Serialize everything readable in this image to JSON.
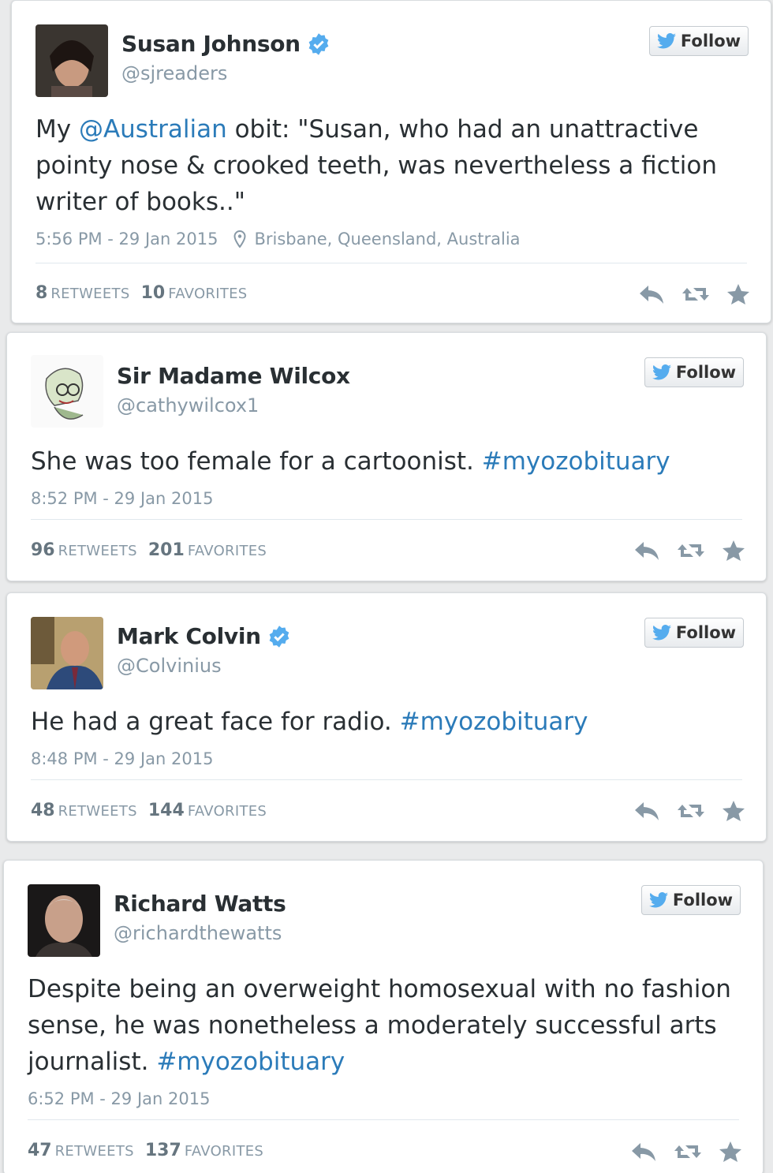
{
  "colors": {
    "link": "#2b7bb9",
    "verified": "#55acee",
    "muted": "#8899a6"
  },
  "follow_label": "Follow",
  "tweets": [
    {
      "name": "Susan Johnson",
      "verified": true,
      "handle": "@sjreaders",
      "text_parts": [
        "My ",
        "@Australian",
        " obit: \"Susan, who had an unattractive pointy nose & crooked teeth, was nevertheless a fiction writer of books..\""
      ],
      "timestamp": "5:56 PM - 29 Jan 2015",
      "location": "Brisbane, Queensland, Australia",
      "retweets": "8",
      "retweets_label": "Retweets",
      "favorites": "10",
      "favorites_label": "Favorites"
    },
    {
      "name": "Sir Madame Wilcox",
      "verified": false,
      "handle": "@cathywilcox1",
      "text_parts": [
        "She was too female for a cartoonist. ",
        "#myozobituary"
      ],
      "timestamp": "8:52 PM - 29 Jan 2015",
      "retweets": "96",
      "retweets_label": "Retweets",
      "favorites": "201",
      "favorites_label": "Favorites"
    },
    {
      "name": "Mark Colvin",
      "verified": true,
      "handle": "@Colvinius",
      "text_parts": [
        "He had a great face for radio. ",
        "#myozobituary"
      ],
      "timestamp": "8:48 PM - 29 Jan 2015",
      "retweets": "48",
      "retweets_label": "Retweets",
      "favorites": "144",
      "favorites_label": "Favorites"
    },
    {
      "name": "Richard Watts",
      "verified": false,
      "handle": "@richardthewatts",
      "text_parts": [
        "Despite being an overweight homosexual with no fashion sense, he was nonetheless a moderately successful arts journalist. ",
        "#myozobituary"
      ],
      "timestamp": "6:52 PM - 29 Jan 2015",
      "retweets": "47",
      "retweets_label": "Retweets",
      "favorites": "137",
      "favorites_label": "Favorites"
    }
  ]
}
